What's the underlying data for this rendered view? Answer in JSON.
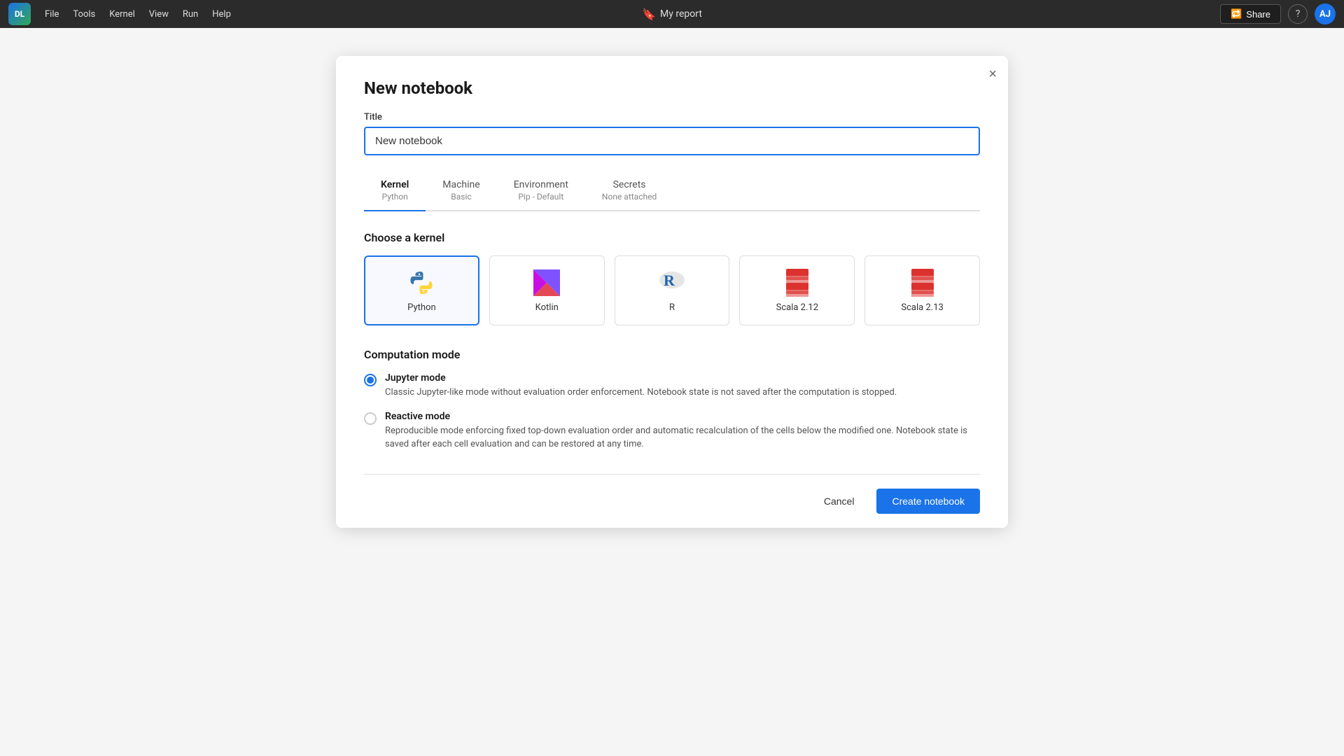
{
  "menubar": {
    "logo": "DL",
    "items": [
      "File",
      "Tools",
      "Kernel",
      "View",
      "Run",
      "Help"
    ],
    "title": "My report",
    "share_label": "Share",
    "help_label": "?",
    "avatar_label": "AJ"
  },
  "dialog": {
    "title": "New notebook",
    "close_label": "×",
    "title_field_label": "Title",
    "title_field_value": "New notebook",
    "tabs": [
      {
        "label": "Kernel",
        "subtitle": "Python",
        "active": true
      },
      {
        "label": "Machine",
        "subtitle": "Basic",
        "active": false
      },
      {
        "label": "Environment",
        "subtitle": "Pip - Default",
        "active": false
      },
      {
        "label": "Secrets",
        "subtitle": "None attached",
        "active": false
      }
    ],
    "kernel_section_title": "Choose a kernel",
    "kernels": [
      {
        "name": "Python",
        "selected": true
      },
      {
        "name": "Kotlin",
        "selected": false
      },
      {
        "name": "R",
        "selected": false
      },
      {
        "name": "Scala 2.12",
        "selected": false
      },
      {
        "name": "Scala 2.13",
        "selected": false
      }
    ],
    "computation_section_title": "Computation mode",
    "modes": [
      {
        "label": "Jupyter mode",
        "description": "Classic Jupyter-like mode without evaluation order enforcement. Notebook state is not saved after the computation is stopped.",
        "checked": true
      },
      {
        "label": "Reactive mode",
        "description": "Reproducible mode enforcing fixed top-down evaluation order and automatic recalculation of the cells below the modified one. Notebook state is saved after each cell evaluation and can be restored at any time.",
        "checked": false
      }
    ],
    "cancel_label": "Cancel",
    "create_label": "Create notebook"
  }
}
